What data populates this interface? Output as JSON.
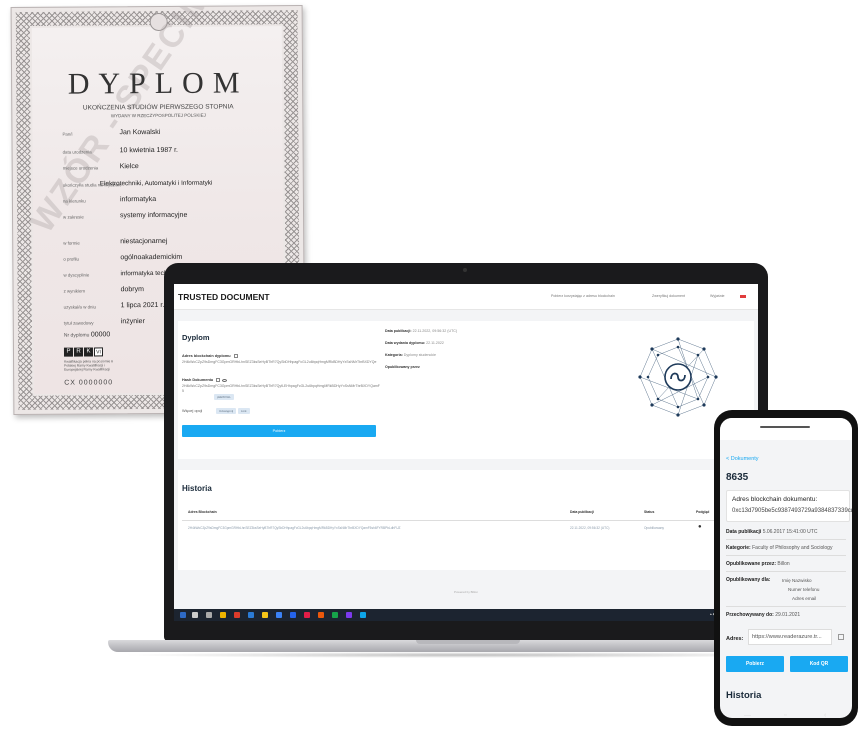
{
  "diploma": {
    "title": "DYPLOM",
    "subtitle": "UKOŃCZENIA STUDIÓW PIERWSZEGO STOPNIA",
    "issuer": "WYDANY W RZECZYPOSPOLITEJ POLSKIEJ",
    "watermark": "WZÓR - SPECIMEN",
    "rows": [
      {
        "label": "Pan/i",
        "value": "Jan Kowalski"
      },
      {
        "label": "data urodzenia",
        "value": "10 kwietnia 1987 r."
      },
      {
        "label": "miejsce urodzenia",
        "value": "Kielce"
      },
      {
        "label": "ukończył/a studia na Wydziale",
        "value": "Elektrotechniki, Automatyki i Informatyki"
      },
      {
        "label": "na kierunku",
        "value": "informatyka"
      },
      {
        "label": "w zakresie",
        "value": "systemy informacyjne"
      },
      {
        "label": "w formie",
        "value": "niestacjonarnej"
      },
      {
        "label": "o profilu",
        "value": "ogólnoakademickim"
      },
      {
        "label": "w dyscyplinie",
        "value": "informatyka techniczna i telekomunikacja"
      },
      {
        "label": "z wynikiem",
        "value": "dobrym"
      },
      {
        "label": "uzyskał/a w dniu",
        "value": "1 lipca 2021 r."
      },
      {
        "label": "tytuł zawodowy",
        "value": "inżynier"
      }
    ],
    "number_label": "Nr dyplomu",
    "number_value": "00000",
    "prk_letters": [
      "P",
      "R",
      "K",
      "VI"
    ],
    "prk_text": "Kwalifikacja pełna na poziomie 6 Polskiej Ramy Kwalifikacji i Europejskiej Ramy Kwalifikacji",
    "serial": "CX 0000000"
  },
  "laptop": {
    "brand": "TRUSTED DOCUMENT",
    "nav": [
      "Pobierz korzystając z adresu blockchain",
      "Zweryfikuj dokument",
      "Wyjaśnie"
    ],
    "document": {
      "title": "Dyplom",
      "blockchain_label": "Adres blockchain dyplomu",
      "blockchain_value": "2H4kWoCZpZ9sDmgFC3GpmGRHbLhnSEZ3ksSeHyBThR7QySbDHhpagFcGL2u6bpqHmgMRkBDHyYxSsNMrTbrBXDYQe",
      "hash_label": "Hash Dokumentu",
      "hash_value": "2H4kWoCZpZ9sDmgFC3GpmGRHbLhnSEZ3ksSeHyBThR7QyfLEHhpagFcGL2u6bpqHmgMRkBDHyYxSsNMrTbrBXDYQamF5",
      "hash_tag": "pkEWVHL",
      "more_label": "Więcej opcji",
      "more_tags": [
        "Udostępnij",
        "Link"
      ],
      "download_label": "Pobierz",
      "meta": [
        {
          "label": "Data publikacji",
          "value": "22.11.2022, 09:56:32 (UTC)"
        },
        {
          "label": "Data wydania dyplomu",
          "value": "22.11.2022"
        },
        {
          "label": "Kategoria",
          "value": "Dyplomy studenckie"
        },
        {
          "label": "Opublikowany przez",
          "value": ""
        }
      ]
    },
    "history": {
      "title": "Historia",
      "columns": [
        "Adres Blockchain",
        "Data publikacji",
        "Status",
        "Podgląd"
      ],
      "rows": [
        {
          "address": "2H4kWoCZpZ9sDmgFC3GpmGRHbLhnSEZ3ksSeHyBThR7QySbDHhpagFcGL2u6bpqHmgMRkBDHyYxSsNMrTbrBXDYQamF5sh6FYRBPbLdhFUZ",
          "date": "22.11.2022, 09:56:32 (UTC)",
          "status": "Opublikowany"
        }
      ]
    },
    "footer": "Powered by Billon",
    "accent_color": "#19a9f2"
  },
  "phone": {
    "back_label": "< Dokumenty",
    "doc_id": "8635",
    "blockchain_label": "Adres blockchain dokumentu:",
    "blockchain_value": "0xc13d7905be5c9387493729a9384837339cd",
    "publication_label": "Data publikacji",
    "publication_value": "5.06.2017 15:41:00 UTC",
    "category_label": "Kategorie:",
    "category_value": "Faculty of Philosophy and Sociology",
    "published_by_label": "Opublikowane przez:",
    "published_by_value": "Billon",
    "published_for_label": "Opublikowany dla:",
    "published_for_lines": [
      "Imię Nazwisko",
      "Numer telefonu",
      "Adres email"
    ],
    "stored_until_label": "Przechowywany do:",
    "stored_until_value": "29.01.2021",
    "address_label": "Adres:",
    "address_value": "https://www.readerazure.tr...",
    "download_label": "Pobierz",
    "qr_label": "Kod QR",
    "history_title": "Historia"
  }
}
